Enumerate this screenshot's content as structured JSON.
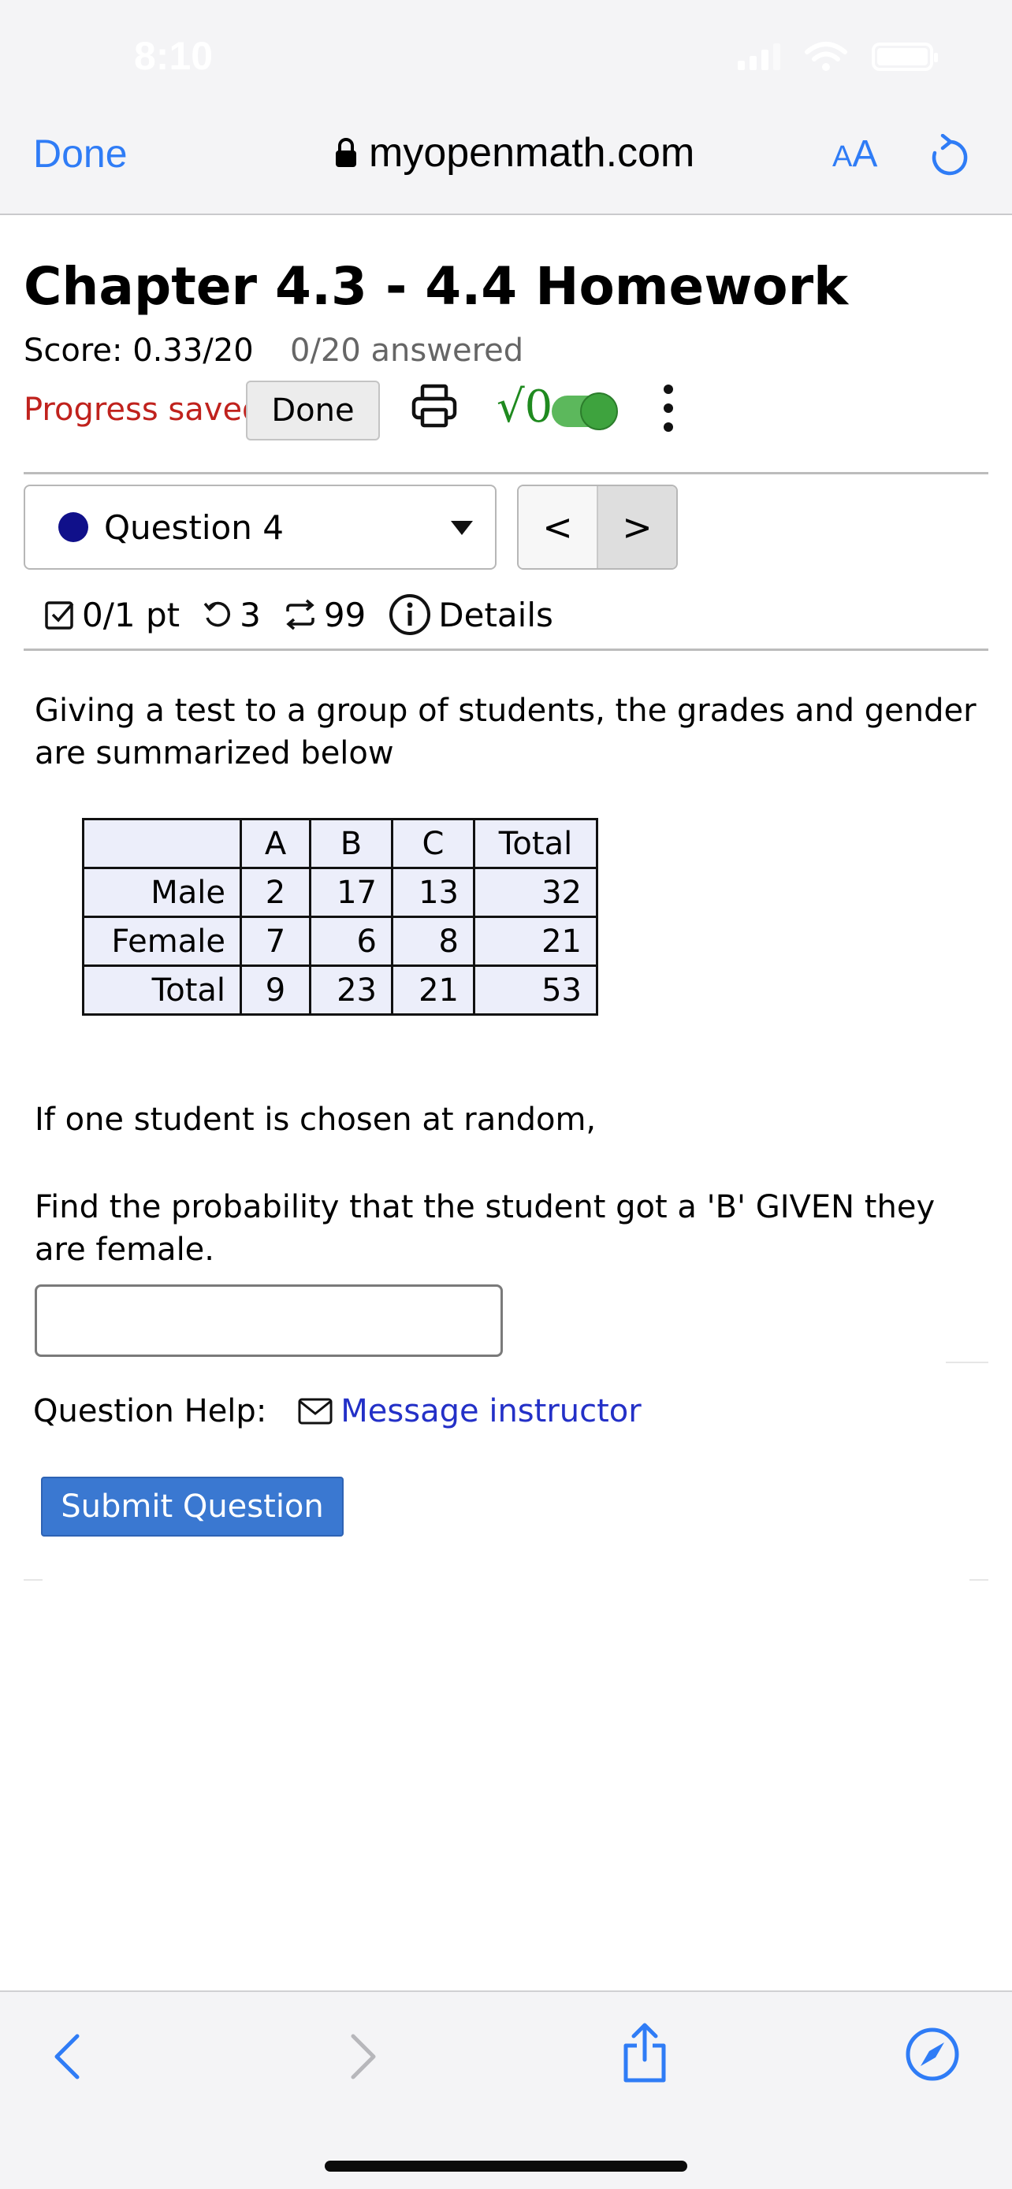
{
  "status_bar": {
    "time": "8:10"
  },
  "browser": {
    "done_label": "Done",
    "url": "myopenmath.com",
    "text_size_label": "AA"
  },
  "assignment": {
    "title": "Chapter 4.3 - 4.4 Homework",
    "score": "Score: 0.33/20",
    "answered": "0/20 answered",
    "progress_saved": "Progress saved",
    "done_button": "Done",
    "math_toggle_label": "√0"
  },
  "question_nav": {
    "current": "Question 4",
    "prev_label": "<",
    "next_label": ">"
  },
  "question_meta": {
    "points": "0/1 pt",
    "attempts": "3",
    "regenerations": "99",
    "details_label": "Details"
  },
  "question": {
    "prompt": "Giving a test to a group of students, the grades and gender are summarized below",
    "table": {
      "header": [
        "",
        "A",
        "B",
        "C",
        "Total"
      ],
      "rows": [
        [
          "Male",
          "2",
          "17",
          "13",
          "32"
        ],
        [
          "Female",
          "7",
          "6",
          "8",
          "21"
        ],
        [
          "Total",
          "9",
          "23",
          "21",
          "53"
        ]
      ]
    },
    "setup": "If one student is chosen at random,",
    "task": "Find the probability that the student got a 'B' GIVEN they are female.",
    "answer_value": "",
    "help_label": "Question Help:",
    "message_link": "Message instructor",
    "submit_label": "Submit Question"
  },
  "colors": {
    "accent": "#2f7cf6",
    "progress_red": "#c0221d",
    "submit_blue": "#3a78d1",
    "link_blue": "#2330c7",
    "toggle_green": "#3ea33e",
    "question_dot": "#10108a"
  }
}
